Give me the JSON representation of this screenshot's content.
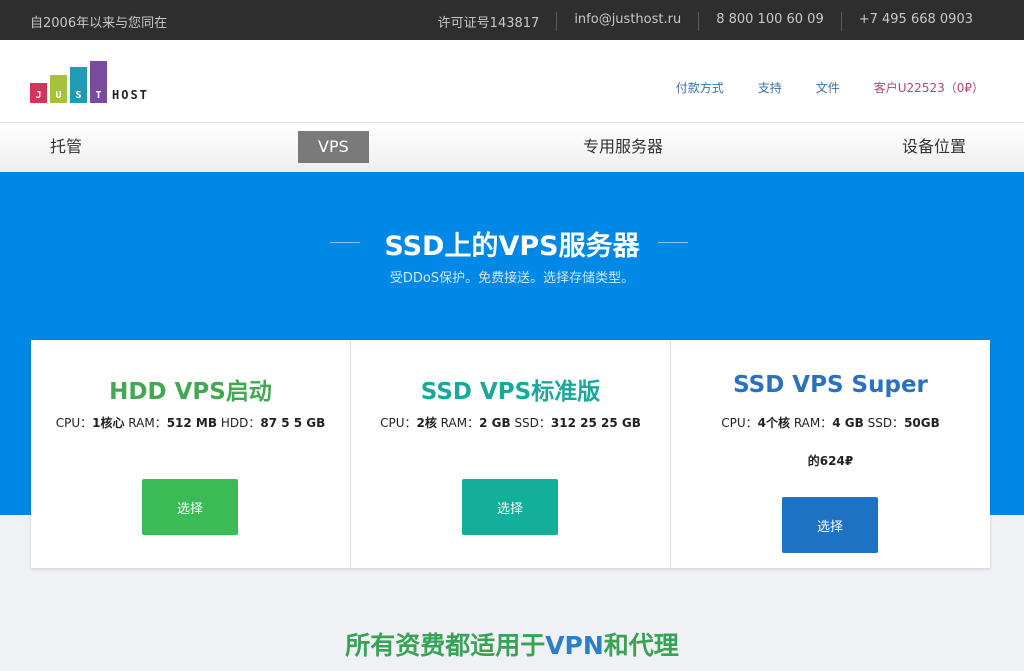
{
  "topbar": {
    "since": "自2006年以来与您同在",
    "license": "许可证号143817",
    "email": "info@justhost.ru",
    "phone1": "8 800 100 60 09",
    "phone2": "+7 495 668 0903"
  },
  "logo": {
    "letters": [
      "J",
      "U",
      "S",
      "T"
    ],
    "host": "HOST",
    "colors": [
      "#d6335a",
      "#a4c33a",
      "#1f9bb3",
      "#7a4aa0"
    ]
  },
  "header": {
    "links": [
      "付款方式",
      "支持",
      "文件"
    ],
    "account": "客户U22523（0₽）"
  },
  "nav": {
    "items": [
      "托管",
      "VPS",
      "专用服务器",
      "设备位置"
    ],
    "active": "VPS"
  },
  "hero": {
    "title": "SSD上的VPS服务器",
    "subtitle": "受DDoS保护。免费接送。选择存储类型。"
  },
  "plans": [
    {
      "title": "HDD VPS启动",
      "title_color": "#43a853",
      "specs": [
        [
          "CPU：",
          "1核心"
        ],
        [
          " RAM：",
          "512 MB"
        ],
        [
          " HDD：",
          "87 5 5 GB"
        ]
      ],
      "price": "",
      "button": "选择",
      "button_color": "#3bbb55"
    },
    {
      "title": "SSD VPS标准版",
      "title_color": "#1aa89a",
      "specs": [
        [
          "CPU：",
          "2核"
        ],
        [
          " RAM：",
          "2 GB"
        ],
        [
          " SSD：",
          "312 25 25 GB"
        ]
      ],
      "price": "",
      "button": "选择",
      "button_color": "#12b09a"
    },
    {
      "title": "SSD VPS Super",
      "title_color": "#2a72c0",
      "specs": [
        [
          "CPU：",
          "4个核"
        ],
        [
          " RAM：",
          "4 GB"
        ],
        [
          " SSD：",
          "50GB"
        ]
      ],
      "price": "的624₽",
      "button": "选择",
      "button_color": "#1d72c4"
    }
  ],
  "bottom": {
    "heading_pre": "所有资费都适用于",
    "heading_acc": "VPN",
    "heading_post": "和代理"
  }
}
